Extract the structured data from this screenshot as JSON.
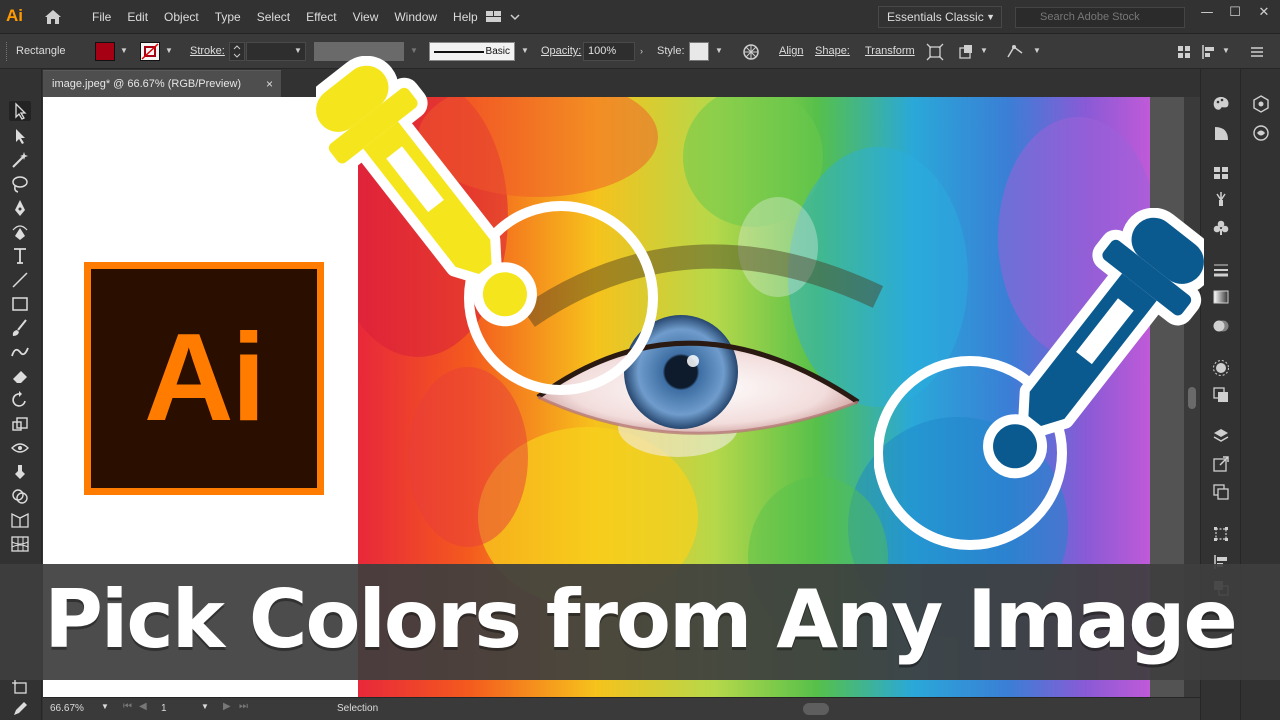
{
  "app": {
    "logo": "Ai"
  },
  "menu": {
    "items": [
      "File",
      "Edit",
      "Object",
      "Type",
      "Select",
      "Effect",
      "View",
      "Window",
      "Help"
    ]
  },
  "workspace": {
    "label": "Essentials Classic"
  },
  "search": {
    "placeholder": "Search Adobe Stock"
  },
  "control_bar": {
    "object_type": "Rectangle",
    "fill_color": "#a50014",
    "stroke_label": "Stroke:",
    "brush_label": "Basic",
    "opacity_label": "Opacity:",
    "opacity_value": "100%",
    "style_label": "Style:",
    "align_label": "Align",
    "shape_label": "Shape:",
    "transform_label": "Transform"
  },
  "document": {
    "tab_title": "image.jpeg* @ 66.67% (RGB/Preview)",
    "close_glyph": "×"
  },
  "status_bar": {
    "zoom": "66.67%",
    "artboard_number": "1",
    "tool_name": "Selection"
  },
  "overlay": {
    "logo_text": "Ai",
    "title": "Pick Colors from Any Image",
    "colors": {
      "brand_orange": "#ff7c00",
      "logo_bg": "#2a0e00",
      "dropper_yellow": "#f5e51c",
      "dropper_blue": "#0a5a8f"
    }
  }
}
